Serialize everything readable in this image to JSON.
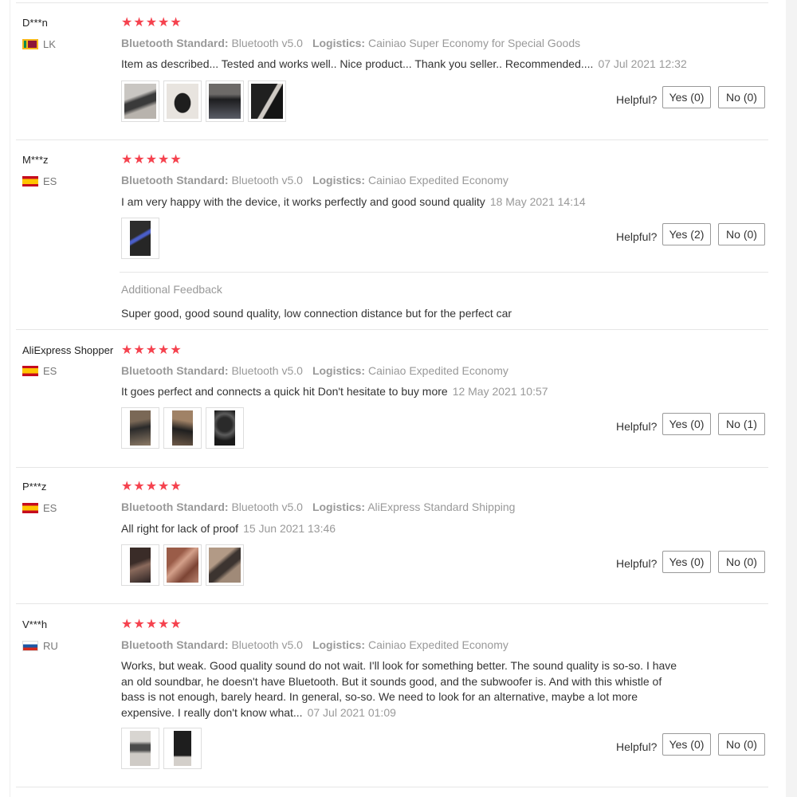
{
  "labels": {
    "bt_label": "Bluetooth Standard:",
    "logistics_label": "Logistics:",
    "helpful": "Helpful?",
    "additional_feedback": "Additional Feedback"
  },
  "reviews": [
    {
      "user": "D***n",
      "country": "LK",
      "stars": "★★★★★",
      "bluetooth": "Bluetooth v5.0",
      "logistics": "Cainiao Super Economy for Special Goods",
      "text": "Item as described... Tested and works well.. Nice product... Thank you seller.. Recommended....",
      "date": "07 Jul 2021 12:32",
      "yes": "Yes (0)",
      "no": "No (0)"
    },
    {
      "user": "M***z",
      "country": "ES",
      "stars": "★★★★★",
      "bluetooth": "Bluetooth v5.0",
      "logistics": "Cainiao Expedited Economy",
      "text": "I am very happy with the device, it works perfectly and good sound quality",
      "date": "18 May 2021 14:14",
      "yes": "Yes (2)",
      "no": "No (0)",
      "feedback": "Super good, good sound quality, low connection distance but for the perfect car"
    },
    {
      "user": "AliExpress Shopper",
      "country": "ES",
      "stars": "★★★★★",
      "bluetooth": "Bluetooth v5.0",
      "logistics": "Cainiao Expedited Economy",
      "text": "It goes perfect and connects a quick hit Don't hesitate to buy more",
      "date": "12 May 2021 10:57",
      "yes": "Yes (0)",
      "no": "No (1)"
    },
    {
      "user": "P***z",
      "country": "ES",
      "stars": "★★★★★",
      "bluetooth": "Bluetooth v5.0",
      "logistics": "AliExpress Standard Shipping",
      "text": "All right for lack of proof",
      "date": "15 Jun 2021 13:46",
      "yes": "Yes (0)",
      "no": "No (0)"
    },
    {
      "user": "V***h",
      "country": "RU",
      "stars": "★★★★★",
      "bluetooth": "Bluetooth v5.0",
      "logistics": "Cainiao Expedited Economy",
      "text": "Works, but weak. Good quality sound do not wait. I'll look for something better. The sound quality is so-so. I have an old soundbar, he doesn't have Bluetooth. But it sounds good, and the subwoofer is. And with this whistle of bass is not enough, barely heard. In general, so-so. We need to look for an alternative, maybe a lot more expensive. I really don't know what...",
      "date": "07 Jul 2021 01:09",
      "yes": "Yes (0)",
      "no": "No (0)"
    }
  ],
  "colors": {
    "star": "#f5424e",
    "muted": "#999999",
    "border": "#e6e6e6"
  }
}
